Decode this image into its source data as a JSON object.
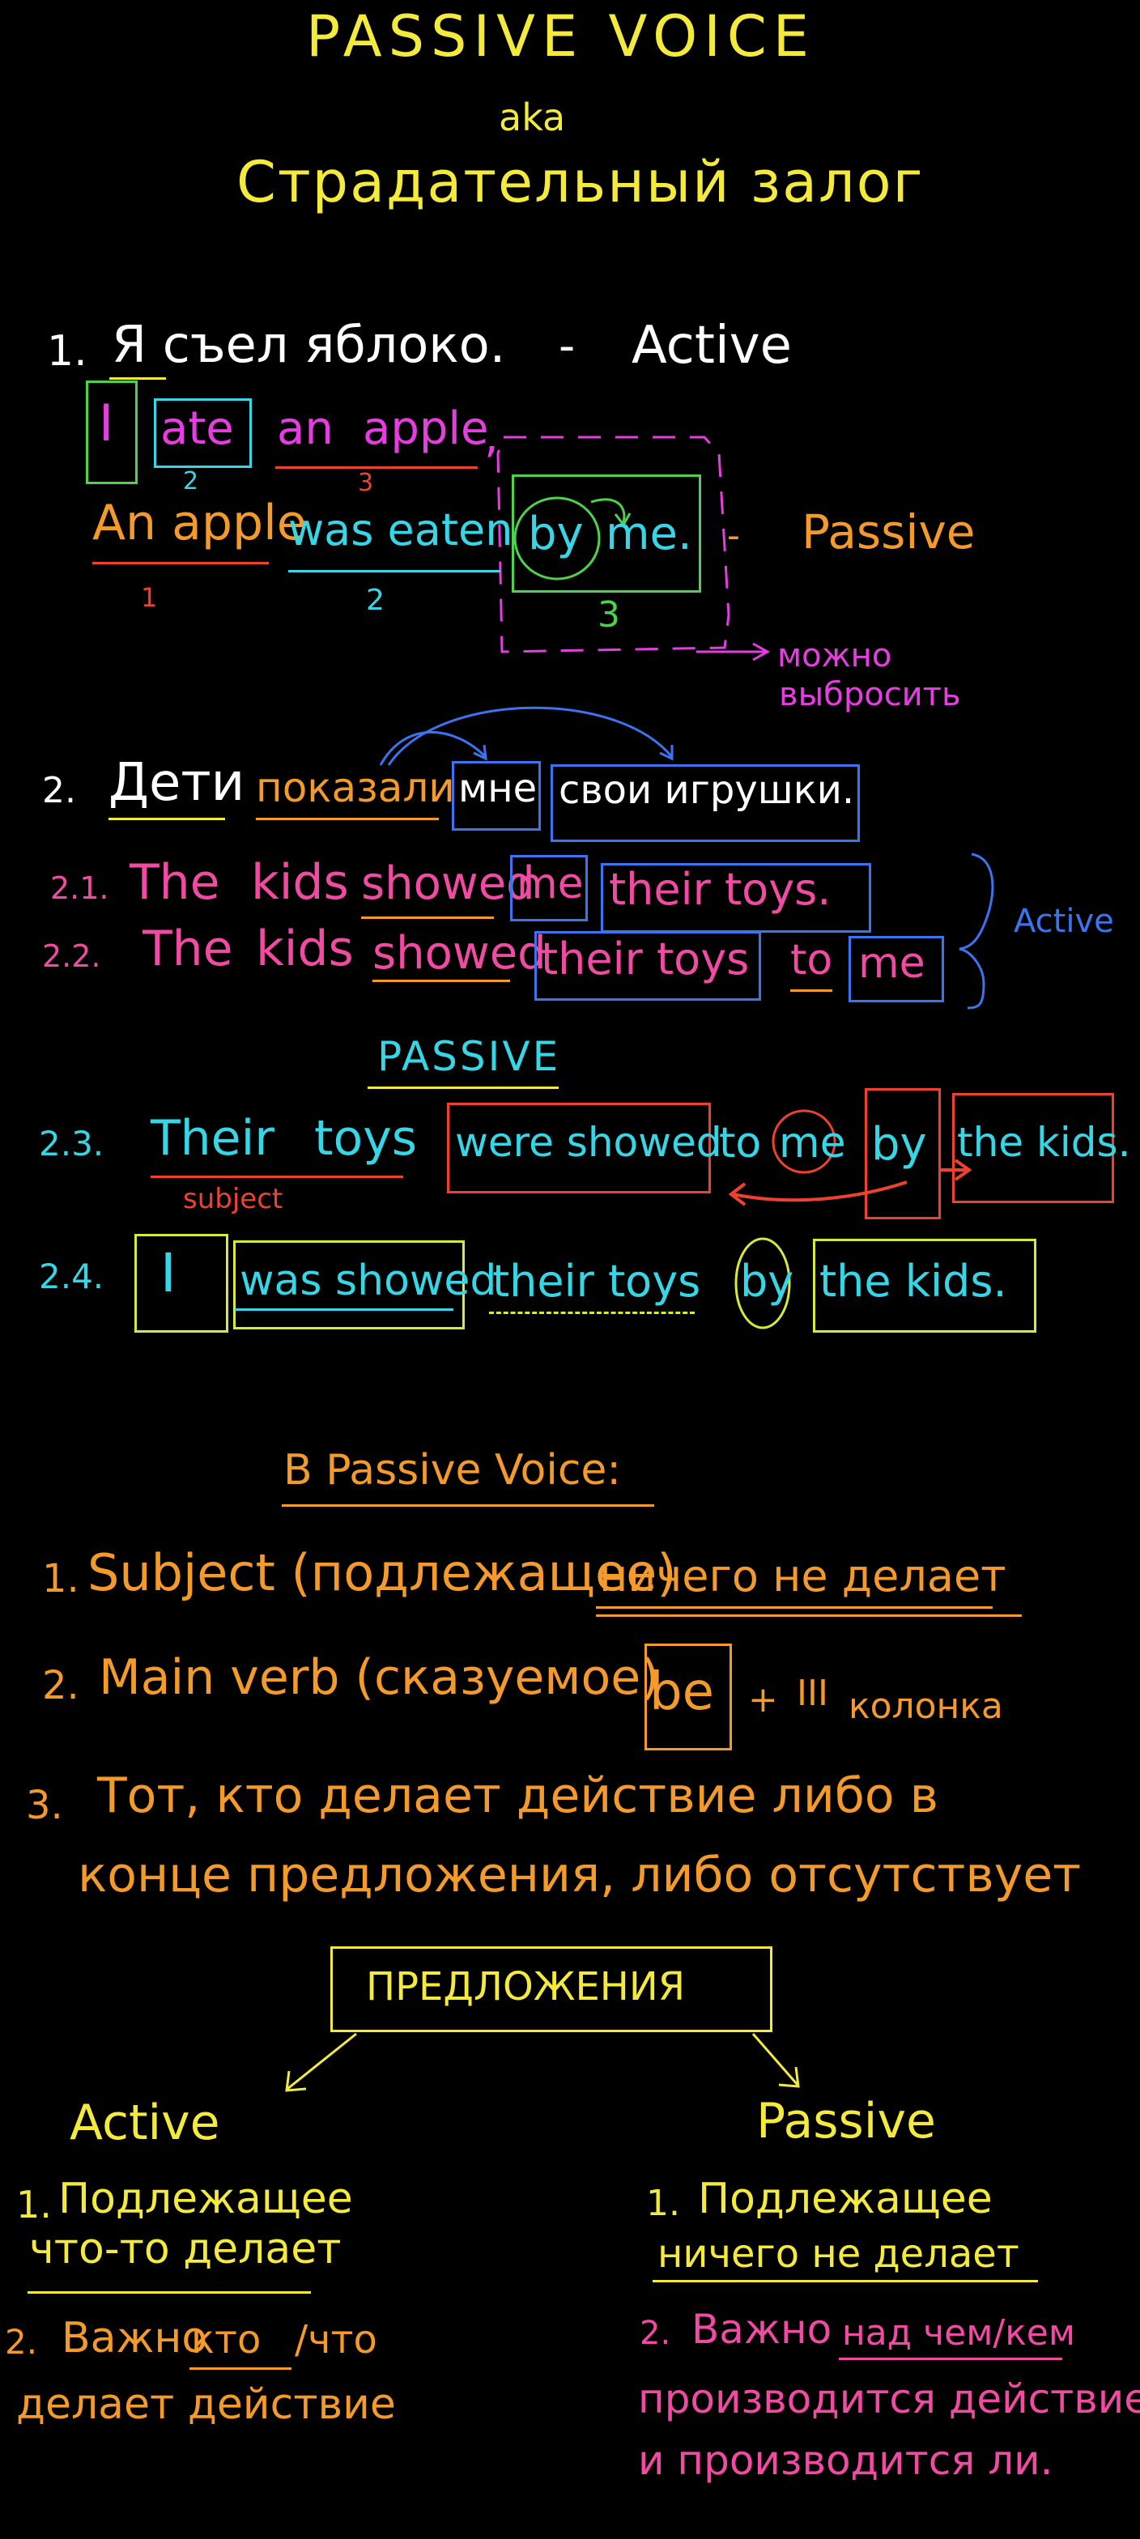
{
  "header": {
    "title": "PASSIVE VOICE",
    "aka": "aka",
    "subtitle": "Страдательный залог"
  },
  "ex1": {
    "num": "1.",
    "ru_sentence": "Я съел яблоко.",
    "dash": "-",
    "active_label": "Active",
    "en_words": [
      "I",
      "ate",
      "an",
      "apple",
      ","
    ],
    "en_nums": [
      "2",
      "3"
    ],
    "passive_words": [
      "An apple",
      "was eaten",
      "by",
      "me."
    ],
    "passive_nums": [
      "1",
      "2",
      "3"
    ],
    "passive_label": "Passive",
    "note_line1": "можно",
    "note_line2": "выбросить"
  },
  "ex2": {
    "num": "2.",
    "ru_words": [
      "Дети",
      "показали",
      "мне",
      "свои игрушки."
    ],
    "s21_num": "2.1.",
    "s21_words": [
      "The",
      "kids",
      "showed",
      "me",
      "their toys."
    ],
    "s22_num": "2.2.",
    "s22_words": [
      "The",
      "kids",
      "showed",
      "their toys",
      "to",
      "me"
    ],
    "active_label": "Active",
    "passive_heading": "PASSIVE",
    "s23_num": "2.3.",
    "s23_words": [
      "Their",
      "toys",
      "were showed",
      "to",
      "me",
      "by",
      "the kids."
    ],
    "subject_label": "subject",
    "s24_num": "2.4.",
    "s24_words": [
      "I",
      "was showed",
      "their toys",
      "by",
      "the kids."
    ]
  },
  "rules": {
    "heading": "В Passive Voice:",
    "r1_num": "1.",
    "r1_text": "Subject (подлежащее)",
    "r1_hl": "ничего не делает",
    "r2_num": "2.",
    "r2_text": "Main verb (сказуемое)",
    "r2_be": "be",
    "r2_plus": "+",
    "r2_col": "III",
    "r2_tail": "колонка",
    "r3_num": "3.",
    "r3_line1": "Тот, кто делает действие либо в",
    "r3_line2": "конце предложения, либо отсутствует"
  },
  "diagram": {
    "root": "ПРЕДЛОЖЕНИЯ",
    "left_title": "Active",
    "left_1_num": "1.",
    "left_1_a": "Подлежащее",
    "left_1_b": "что-то делает",
    "left_2_num": "2.",
    "left_2_a": "Важно",
    "left_2_hl": "кто",
    "left_2_c": "/что",
    "left_2_d": "делает действие",
    "right_title": "Passive",
    "right_1_num": "1.",
    "right_1_a": "Подлежащее",
    "right_1_b": "ничего не делает",
    "right_2_num": "2.",
    "right_2_a": "Важно",
    "right_2_hl": "над чем/кем",
    "right_2_c": "производится действие",
    "right_2_d": "и производится ли."
  },
  "colors": {
    "background": "#000000",
    "yellow": "#f3ea3c",
    "magenta": "#e63de0",
    "orange": "#f39a2a",
    "cyan": "#35d6e6",
    "green": "#4fd24b",
    "red": "#f0412f",
    "pink": "#f14aa3",
    "blue": "#3b74f0"
  }
}
